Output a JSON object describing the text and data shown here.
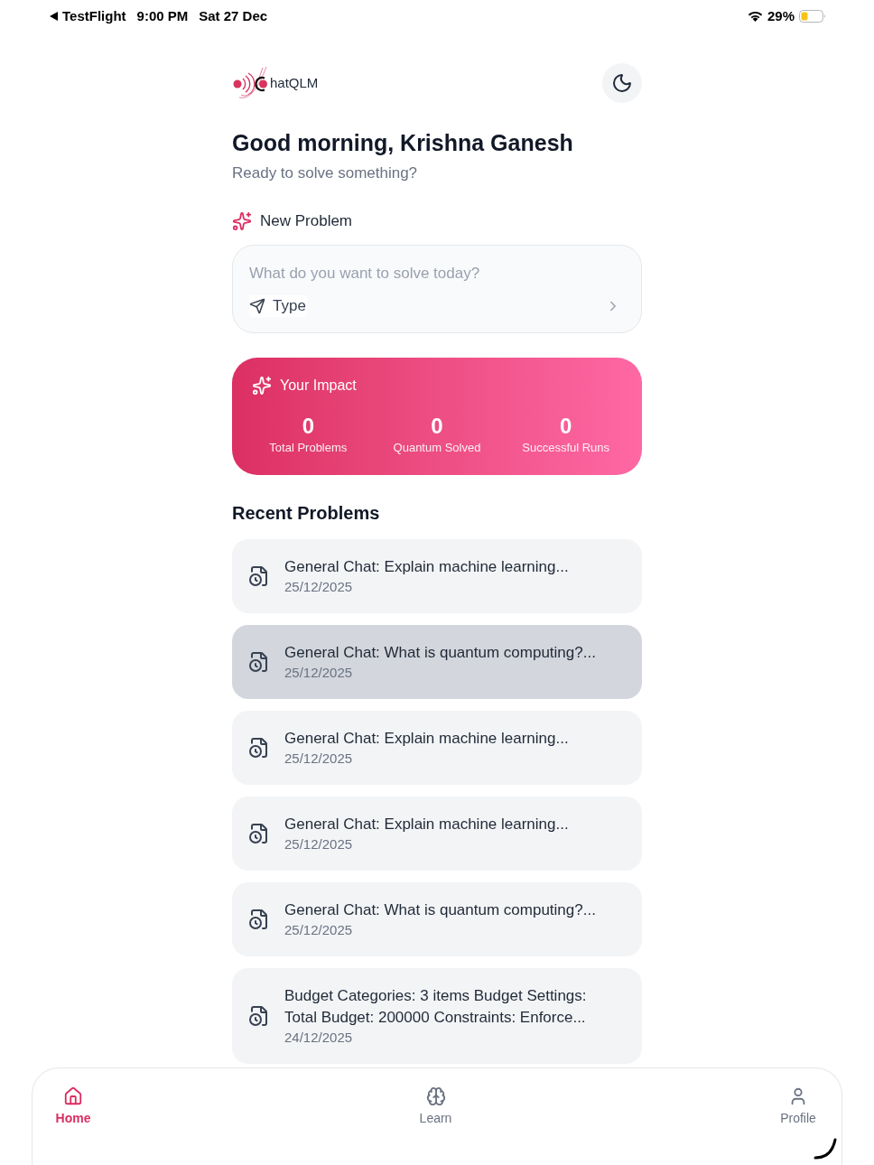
{
  "status_bar": {
    "back_app": "TestFlight",
    "time": "9:00 PM",
    "date": "Sat 27 Dec",
    "battery": "29%"
  },
  "header": {
    "logo_text": "hatQLM"
  },
  "greeting": {
    "title": "Good morning, Krishna Ganesh",
    "subtitle": "Ready to solve something?"
  },
  "new_problem": {
    "label": "New Problem",
    "placeholder": "What do you want to solve today?",
    "mode_button": "Type"
  },
  "impact": {
    "title": "Your Impact",
    "stats": [
      {
        "value": "0",
        "label": "Total Problems"
      },
      {
        "value": "0",
        "label": "Quantum Solved"
      },
      {
        "value": "0",
        "label": "Successful Runs"
      }
    ]
  },
  "recent_problems": {
    "title": "Recent Problems",
    "items": [
      {
        "title": "General Chat: Explain machine learning...",
        "date": "25/12/2025",
        "selected": false
      },
      {
        "title": "General Chat: What is quantum computing?...",
        "date": "25/12/2025",
        "selected": true
      },
      {
        "title": "General Chat: Explain machine learning...",
        "date": "25/12/2025",
        "selected": false
      },
      {
        "title": "General Chat: Explain machine learning...",
        "date": "25/12/2025",
        "selected": false
      },
      {
        "title": "General Chat: What is quantum computing?...",
        "date": "25/12/2025",
        "selected": false
      },
      {
        "title": "Budget Categories: 3 items Budget Settings: Total Budget: 200000 Constraints: Enforce...",
        "date": "24/12/2025",
        "selected": false
      }
    ]
  },
  "nav": {
    "items": [
      {
        "label": "Home",
        "selected": true
      },
      {
        "label": "Learn",
        "selected": false
      },
      {
        "label": "Profile",
        "selected": false
      }
    ]
  }
}
